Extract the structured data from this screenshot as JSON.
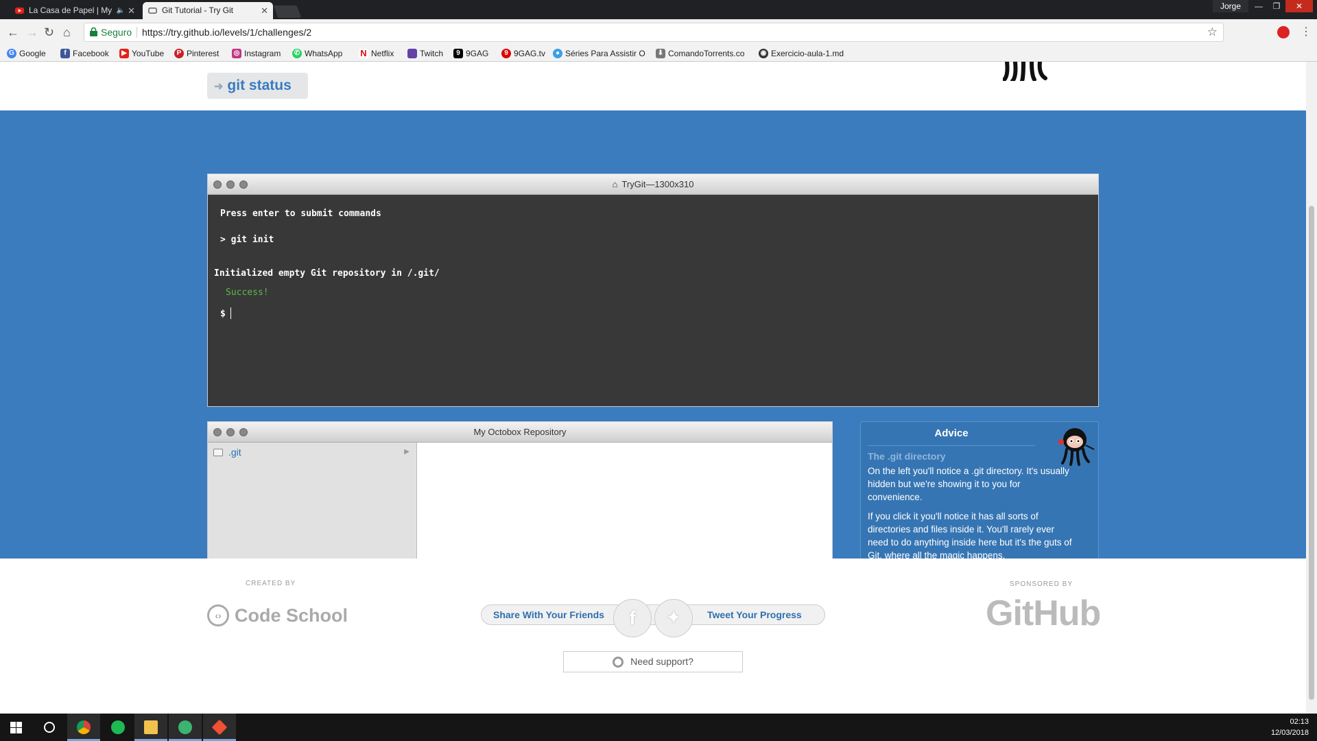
{
  "browser": {
    "tabs": [
      {
        "title": "La Casa de Papel | My",
        "active": false
      },
      {
        "title": "Git Tutorial - Try Git",
        "active": true
      }
    ],
    "user": "Jorge",
    "security_label": "Seguro",
    "url": "https://try.github.io/levels/1/challenges/2",
    "bookmarks": [
      "Google",
      "Facebook",
      "YouTube",
      "Pinterest",
      "Instagram",
      "WhatsApp",
      "Netflix",
      "Twitch",
      "9GAG",
      "9GAG.tv",
      "Séries Para Assistir O",
      "ComandoTorrents.co",
      "Exercicio-aula-1.md"
    ]
  },
  "hint": {
    "command": "git status"
  },
  "terminal": {
    "title": "TryGit—1300x310",
    "lines": [
      "Press enter to submit commands",
      "> git init",
      "Initialized empty Git repository in /.git/",
      "Success!",
      "$"
    ]
  },
  "repo": {
    "title": "My Octobox Repository",
    "folder": ".git"
  },
  "advice": {
    "title": "Advice",
    "subtitle": "The .git directory",
    "para1": "On the left you'll notice a .git directory. It's usually hidden but we're showing it to you for convenience.",
    "para2": "If you click it you'll notice it has all sorts of directories and files inside it. You'll rarely ever need to do anything inside here but it's the guts of Git, where all the magic happens."
  },
  "footer": {
    "created_by": "CREATED BY",
    "code_school": "Code School",
    "share": "Share With Your Friends",
    "tweet": "Tweet Your Progress",
    "sponsored_by": "SPONSORED BY",
    "github": "GitHub",
    "support": "Need support?"
  },
  "taskbar": {
    "time": "02:13",
    "date": "12/03/2018"
  },
  "colors": {
    "page_blue": "#3a7cbd",
    "link_blue": "#2f6fad",
    "success_green": "#5dba4c"
  }
}
